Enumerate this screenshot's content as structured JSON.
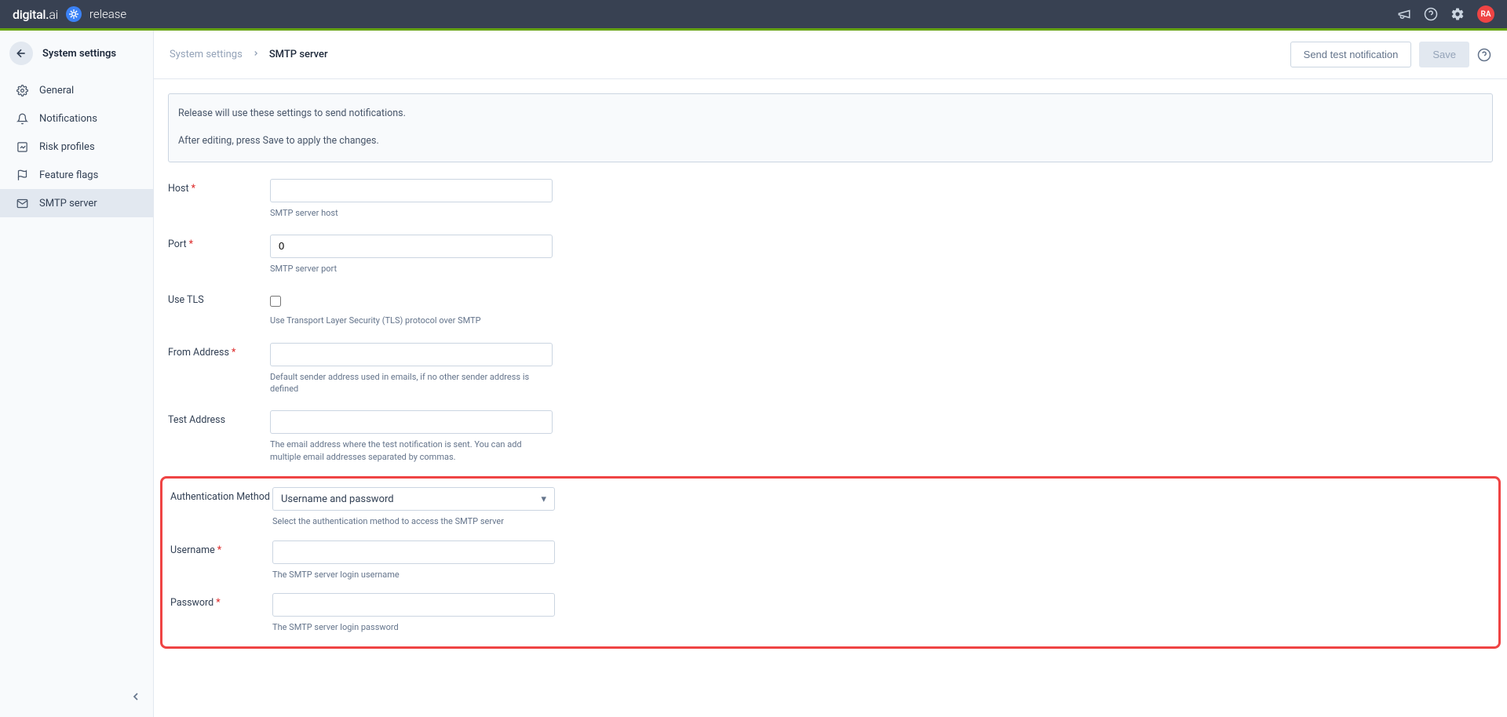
{
  "topbar": {
    "logo_text": "digital.",
    "logo_suffix": "ai",
    "product": "release",
    "avatar_initials": "RA"
  },
  "sidebar": {
    "title": "System settings",
    "items": [
      {
        "label": "General",
        "active": false
      },
      {
        "label": "Notifications",
        "active": false
      },
      {
        "label": "Risk profiles",
        "active": false
      },
      {
        "label": "Feature flags",
        "active": false
      },
      {
        "label": "SMTP server",
        "active": true
      }
    ]
  },
  "breadcrumb": {
    "parent": "System settings",
    "current": "SMTP server"
  },
  "actions": {
    "test_label": "Send test notification",
    "save_label": "Save"
  },
  "info": {
    "line1": "Release will use these settings to send notifications.",
    "line2": "After editing, press Save to apply the changes."
  },
  "form": {
    "host": {
      "label": "Host",
      "value": "",
      "help": "SMTP server host",
      "required": true
    },
    "port": {
      "label": "Port",
      "value": "0",
      "help": "SMTP server port",
      "required": true
    },
    "tls": {
      "label": "Use TLS",
      "checked": false,
      "help": "Use Transport Layer Security (TLS) protocol over SMTP"
    },
    "from": {
      "label": "From Address",
      "value": "",
      "help": "Default sender address used in emails, if no other sender address is defined",
      "required": true
    },
    "test": {
      "label": "Test Address",
      "value": "",
      "help": "The email address where the test notification is sent. You can add multiple email addresses separated by commas."
    },
    "auth": {
      "label": "Authentication Method",
      "value": "Username and password",
      "help": "Select the authentication method to access the SMTP server",
      "required": true
    },
    "username": {
      "label": "Username",
      "value": "",
      "help": "The SMTP server login username",
      "required": true
    },
    "password": {
      "label": "Password",
      "value": "",
      "help": "The SMTP server login password",
      "required": true
    }
  }
}
